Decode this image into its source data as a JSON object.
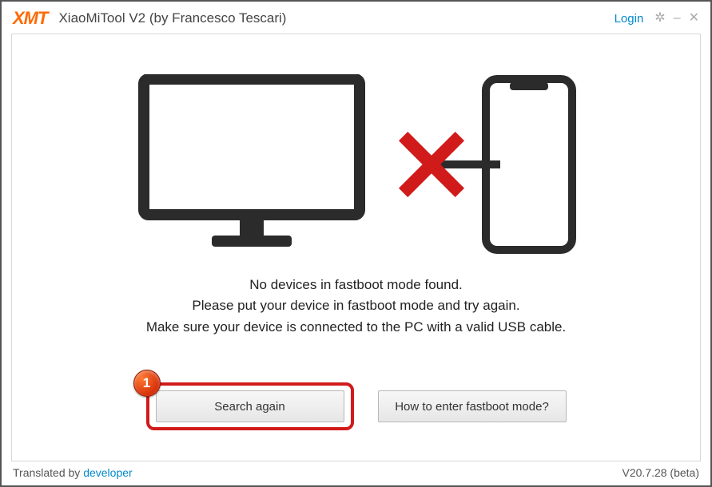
{
  "header": {
    "logo_text": "XMT",
    "title": "XiaoMiTool V2 (by Francesco Tescari)",
    "login_label": "Login"
  },
  "graphic": {
    "monitor_icon": "monitor-icon",
    "phone_icon": "phone-icon",
    "cross_icon": "red-cross-icon"
  },
  "message": {
    "line1": "No devices in fastboot mode found.",
    "line2": "Please put your device in fastboot mode and try again.",
    "line3": "Make sure your device is connected to the PC with a valid USB cable."
  },
  "buttons": {
    "search_again": "Search again",
    "how_to_fastboot": "How to enter fastboot mode?"
  },
  "annotation": {
    "badge_number": "1"
  },
  "footer": {
    "translated_by_prefix": "Translated by ",
    "developer_link": "developer",
    "version": "V20.7.28 (beta)"
  }
}
